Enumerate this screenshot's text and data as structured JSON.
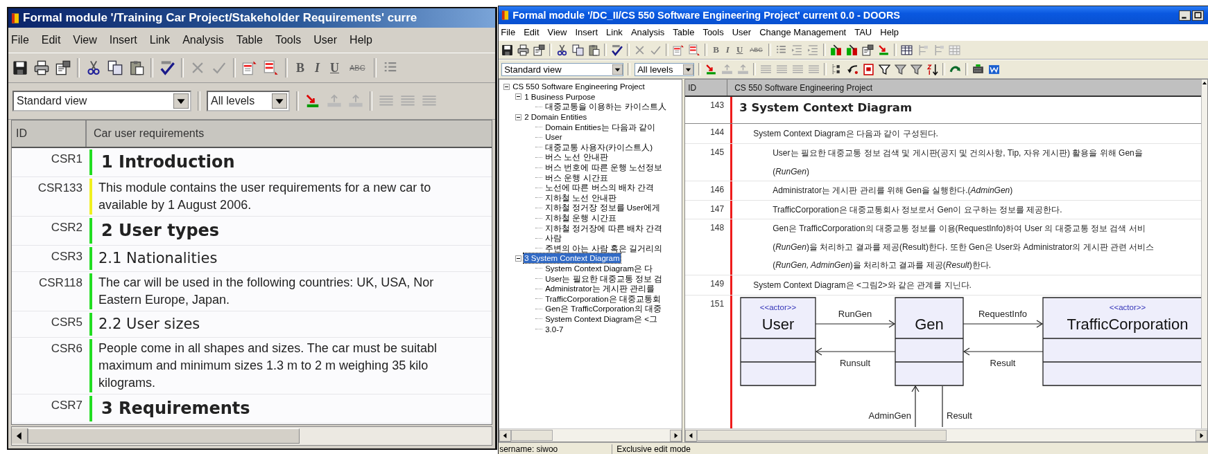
{
  "left_window": {
    "title": "Formal module '/Training Car Project/Stakeholder Requirements' curre",
    "menu": [
      "File",
      "Edit",
      "View",
      "Insert",
      "Link",
      "Analysis",
      "Table",
      "Tools",
      "User",
      "Help"
    ],
    "format_buttons": [
      {
        "label": "B",
        "kind": "bold",
        "disabled": false
      },
      {
        "label": "I",
        "kind": "italic",
        "disabled": false
      },
      {
        "label": "U",
        "kind": "underline",
        "disabled": false
      },
      {
        "label": "ABC",
        "kind": "strike",
        "disabled": true
      }
    ],
    "view": "Standard view",
    "levels": "All levels",
    "columns": [
      "ID",
      "Car user requirements"
    ],
    "rows": [
      {
        "id": "CSR1",
        "kind": "heading",
        "color": "#22dd22",
        "lines": [
          "1 Introduction"
        ]
      },
      {
        "id": "CSR133",
        "kind": "text",
        "color": "#f0f020",
        "lines": [
          "This module contains the user requirements for a new car to",
          "available by 1 August 2006."
        ]
      },
      {
        "id": "CSR2",
        "kind": "heading",
        "color": "#22dd22",
        "lines": [
          "2 User types"
        ]
      },
      {
        "id": "CSR3",
        "kind": "subheading",
        "color": "#22dd22",
        "lines": [
          "2.1 Nationalities"
        ]
      },
      {
        "id": "CSR118",
        "kind": "text",
        "color": "#22dd22",
        "lines": [
          "The car will be used in the following countries: UK, USA, Nor",
          "Eastern Europe, Japan."
        ]
      },
      {
        "id": "CSR5",
        "kind": "subheading",
        "color": "#22dd22",
        "lines": [
          "2.2 User sizes"
        ]
      },
      {
        "id": "CSR6",
        "kind": "text",
        "color": "#22dd22",
        "lines": [
          "People come in all shapes and sizes. The car must be suitabl",
          "maximum and minimum sizes 1.3 m to 2 m weighing 35 kilo",
          "kilograms."
        ]
      },
      {
        "id": "CSR7",
        "kind": "heading",
        "color": "#22dd22",
        "lines": [
          "3 Requirements"
        ]
      }
    ]
  },
  "right_window": {
    "title": "Formal module '/DC_II/CS 550 Software Engineering Project' current 0.0 - DOORS",
    "menu": [
      "File",
      "Edit",
      "View",
      "Insert",
      "Link",
      "Analysis",
      "Table",
      "Tools",
      "User",
      "Change Management",
      "TAU",
      "Help"
    ],
    "format_buttons": [
      {
        "label": "B",
        "kind": "bold",
        "disabled": true
      },
      {
        "label": "I",
        "kind": "italic",
        "disabled": true
      },
      {
        "label": "U",
        "kind": "underline",
        "disabled": true
      },
      {
        "label": "ABC",
        "kind": "strike",
        "disabled": true
      }
    ],
    "view": "Standard view",
    "levels": "All levels",
    "tree": [
      {
        "label": "CS 550 Software Engineering Project",
        "expanded": true,
        "selected": false,
        "children": [
          {
            "label": "1 Business Purpose",
            "expanded": true,
            "selected": false,
            "children": [
              {
                "label": "대중교통을 이용하는 카이스트人",
                "selected": false
              }
            ]
          },
          {
            "label": "2 Domain Entities",
            "expanded": true,
            "selected": false,
            "children": [
              {
                "label": "Domain Entities는 다음과 같이",
                "selected": false
              },
              {
                "label": "User",
                "selected": false
              },
              {
                "label": "대중교통 사용자(카이스트人)",
                "selected": false
              },
              {
                "label": "버스 노선 안내판",
                "selected": false
              },
              {
                "label": "버스 번호에 따른 운행 노선정보",
                "selected": false
              },
              {
                "label": "버스 운행 시간표",
                "selected": false
              },
              {
                "label": "노선에 따른 버스의 배차 간격",
                "selected": false
              },
              {
                "label": "지하철 노선 안내판",
                "selected": false
              },
              {
                "label": "지하철 정거장 정보를 User에게",
                "selected": false
              },
              {
                "label": "지하철 운행 시간표",
                "selected": false
              },
              {
                "label": "지하철 정거장에 따른 배차 간격",
                "selected": false
              },
              {
                "label": "사람",
                "selected": false
              },
              {
                "label": "주변의 아는 사람 혹은 길거리의",
                "selected": false
              }
            ]
          },
          {
            "label": "3 System Context Diagram",
            "expanded": true,
            "selected": true,
            "children": [
              {
                "label": "System Context Diagram은 다",
                "selected": false
              },
              {
                "label": "User는 필요한 대중교통 정보 검",
                "selected": false
              },
              {
                "label": "Administrator는 게시판 관리를",
                "selected": false
              },
              {
                "label": "TrafficCorporation은 대중교통회",
                "selected": false
              },
              {
                "label": "Gen은 TrafficCorporation의 대중",
                "selected": false
              },
              {
                "label": "System Context Diagram은 <그",
                "selected": false
              },
              {
                "label": "3.0-7",
                "selected": false
              }
            ]
          }
        ]
      }
    ],
    "columns": [
      "ID",
      "CS 550 Software Engineering Project"
    ],
    "rows": [
      {
        "id": "143",
        "kind": "heading",
        "lines": [
          "3 System Context Diagram"
        ]
      },
      {
        "id": "144",
        "kind": "paragraph",
        "lines": [
          "System Context Diagram은 다음과 같이 구성된다."
        ]
      },
      {
        "id": "145",
        "kind": "subparagraph",
        "lines": [
          "User는 필요한 대중교통 정보 검색 및 게시판(공지 및 건의사항, Tip, 자유 게시판) 활용을 위해 Gen을",
          "(*RunGen*)"
        ]
      },
      {
        "id": "146",
        "kind": "subparagraph",
        "lines": [
          "Administrator는 게시판 관리를 위해 Gen을 실행한다.(*AdminGen*)"
        ]
      },
      {
        "id": "147",
        "kind": "subparagraph",
        "lines": [
          "TrafficCorporation은 대중교통회사 정보로서 Gen이 요구하는 정보를 제공한다."
        ]
      },
      {
        "id": "148",
        "kind": "subparagraph",
        "lines": [
          "Gen은 TrafficCorporation의 대중교통 정보를 이용(RequestInfo)하여 User 의  대중교통 정보 검색 서비",
          "(*RunGen*)을 처리하고 결과를 제공(Result)한다. 또한 Gen은 User와 Administrator의 게시판 관련 서비스",
          "(*RunGen, AdminGen*)을 처리하고 결과를 제공(*Result*)한다."
        ]
      },
      {
        "id": "149",
        "kind": "paragraph",
        "lines": [
          "System Context Diagram은 <그림2>와 같은 관계를 지닌다."
        ]
      },
      {
        "id": "151",
        "kind": "diagram",
        "diagram": {
          "classes": [
            {
              "stereotype": "<<actor>>",
              "name": "User"
            },
            {
              "name": "Gen"
            },
            {
              "stereotype": "<<actor>>",
              "name": "TrafficCorporation"
            }
          ],
          "links": [
            {
              "label": "RunGen"
            },
            {
              "label": "Runsult"
            },
            {
              "label": "RequestInfo"
            },
            {
              "label": "Result"
            },
            {
              "label": "AdminGen"
            },
            {
              "label": "Result"
            }
          ]
        }
      }
    ],
    "status": [
      "sername: siwoo",
      "Exclusive edit mode"
    ]
  }
}
